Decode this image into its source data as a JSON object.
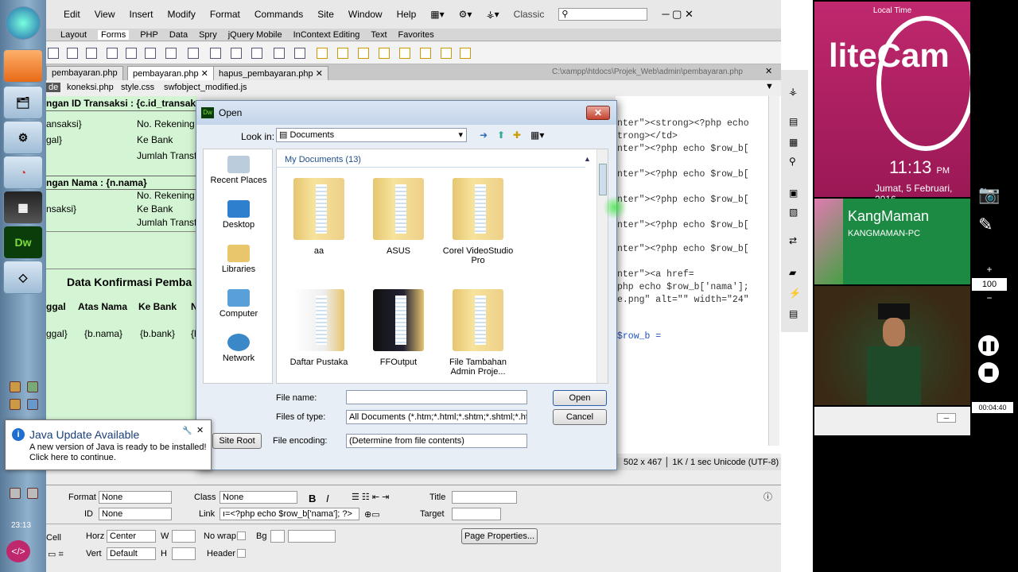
{
  "taskbar": {
    "clock": "23:13",
    "app_buttons": [
      "windows-orb",
      "uc-browser",
      "file-explorer",
      "tool",
      "shape",
      "video-editor",
      "dreamweaver",
      "app"
    ]
  },
  "dw": {
    "menu": [
      "Edit",
      "View",
      "Insert",
      "Modify",
      "Format",
      "Commands",
      "Site",
      "Window",
      "Help"
    ],
    "workspace": "Classic",
    "search_placeholder": "",
    "insert_tabs": [
      "Layout",
      "Forms",
      "PHP",
      "Data",
      "Spry",
      "jQuery Mobile",
      "InContext Editing",
      "Text",
      "Favorites"
    ],
    "doc_tabs": [
      "pembayaran.php",
      "pembayaran.php",
      "hapus_pembayaran.php"
    ],
    "path": "C:\\xampp\\htdocs\\Projek_Web\\admin\\pembayaran.php",
    "related_files": [
      "de",
      "koneksi.php",
      "style.css",
      "swfobject_modified.js"
    ],
    "design": {
      "transaksi_header": "ngan ID Transaksi : {c.id_transak",
      "rows1": [
        [
          "ansaksi}",
          "No. Rekening"
        ],
        [
          "gal}",
          "Ke Bank"
        ],
        [
          "",
          "Jumlah Transf"
        ]
      ],
      "nama_header": "ngan Nama : {n.nama}",
      "rows2": [
        [
          "",
          "No. Rekening"
        ],
        [
          "nsaksi}",
          "Ke Bank"
        ],
        [
          "",
          "Jumlah Transf"
        ]
      ],
      "konfirmasi_title": "Data Konfirmasi Pemba",
      "table_headers": [
        "ggal",
        "Atas Nama",
        "Ke Bank",
        "N"
      ],
      "table_row": [
        "ggal}",
        "{b.nama}",
        "{b.bank}",
        "{l"
      ]
    },
    "code": [
      "nter\"><strong><?php echo",
      "trong></td>",
      "nter\"><?php echo $row_b[",
      "nter\"><?php echo $row_b[",
      "nter\"><?php echo $row_b[",
      "nter\"><?php echo $row_b[",
      "nter\"><?php echo $row_b[",
      "nter\"><a href=",
      "php echo $row_b['nama'];",
      "e.png\" alt=\"\" width=\"24\"",
      "$row_b ="
    ],
    "status": {
      "size": "502 x 467",
      "speed": "1K / 1 sec",
      "encoding": "Unicode (UTF-8)"
    },
    "props": {
      "format_label": "Format",
      "format_value": "None",
      "class_label": "Class",
      "class_value": "None",
      "id_label": "ID",
      "id_value": "None",
      "link_label": "Link",
      "link_value": "ı=<?php echo $row_b['nama']; ?>",
      "title_label": "Title",
      "target_label": "Target",
      "cell_label": "Cell",
      "horz_label": "Horz",
      "horz_value": "Center",
      "w_label": "W",
      "nowrap_label": "No wrap",
      "bg_label": "Bg",
      "vert_label": "Vert",
      "vert_value": "Default",
      "h_label": "H",
      "header_label": "Header",
      "page_props": "Page Properties..."
    }
  },
  "dialog": {
    "title": "Open",
    "look_in_label": "Look in:",
    "look_in_value": "Documents",
    "places": [
      "Recent Places",
      "Desktop",
      "Libraries",
      "Computer",
      "Network"
    ],
    "group_title": "My Documents (13)",
    "folders": [
      "aa",
      "ASUS",
      "Corel VideoStudio Pro",
      "Daftar Pustaka",
      "FFOutput",
      "File Tambahan Admin  Proje..."
    ],
    "file_name_label": "File name:",
    "file_name_value": "",
    "files_of_type_label": "Files of type:",
    "files_of_type_value": "All Documents (*.htm;*.html;*.shtm;*.shtml;*.hta;",
    "encoding_label": "File encoding:",
    "encoding_value": "(Determine from file contents)",
    "open_btn": "Open",
    "cancel_btn": "Cancel",
    "site_root_btn": "Site Root"
  },
  "java": {
    "title": "Java Update Available",
    "body": "A new version of Java is ready to be installed! Click here to continue."
  },
  "litecam": {
    "local_time_label": "Local Time",
    "logo": "liteCam",
    "time": "11:13",
    "ampm": "PM",
    "date": "Jumat, 5 Februari, 2016",
    "user": "KangMaman",
    "pc": "KANGMAMAN-PC",
    "zoom": "100",
    "rec_time": "00:04:40"
  },
  "colors": {
    "design_bg": "#d4f5d4",
    "lc_pink": "#c0286e",
    "lc_green": "#1d8a43",
    "code_kw": "#a31515"
  }
}
